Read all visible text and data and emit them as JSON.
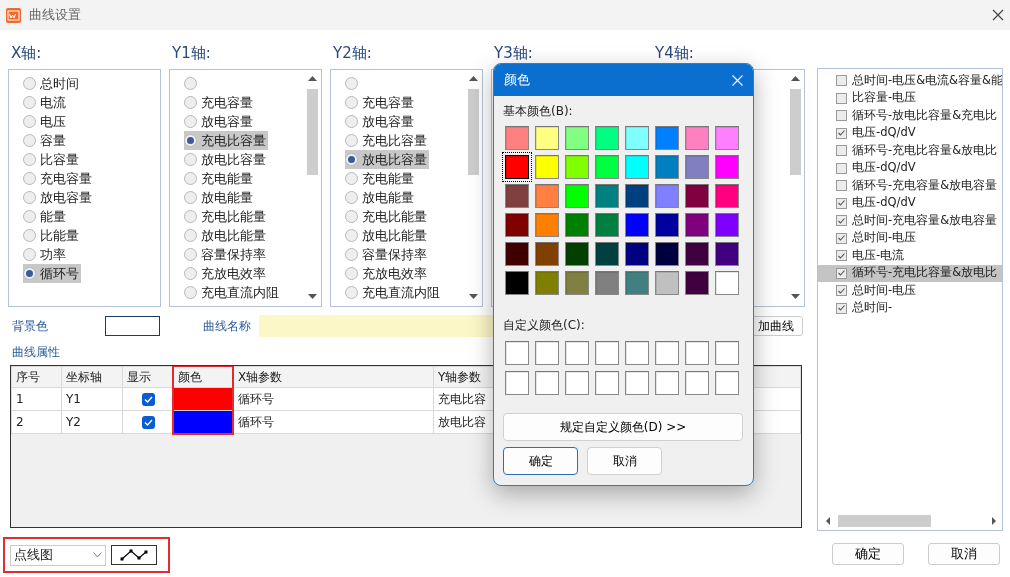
{
  "window": {
    "title": "曲线设置"
  },
  "axes": [
    {
      "label": "X轴:",
      "kind": "plain",
      "items": [
        {
          "label": "总时间",
          "selected": false
        },
        {
          "label": "电流",
          "selected": false
        },
        {
          "label": "电压",
          "selected": false
        },
        {
          "label": "容量",
          "selected": false
        },
        {
          "label": "比容量",
          "selected": false
        },
        {
          "label": "充电容量",
          "selected": false
        },
        {
          "label": "放电容量",
          "selected": false
        },
        {
          "label": "能量",
          "selected": false
        },
        {
          "label": "比能量",
          "selected": false
        },
        {
          "label": "功率",
          "selected": false
        },
        {
          "label": "循环号",
          "selected": true
        }
      ]
    },
    {
      "label": "Y1轴:",
      "kind": "scrolling",
      "items": [
        {
          "selected": false
        },
        {
          "label": "充电容量",
          "selected": false
        },
        {
          "label": "放电容量",
          "selected": false
        },
        {
          "label": "充电比容量",
          "selected": true
        },
        {
          "label": "放电比容量",
          "selected": false
        },
        {
          "label": "充电能量",
          "selected": false
        },
        {
          "label": "放电能量",
          "selected": false
        },
        {
          "label": "充电比能量",
          "selected": false
        },
        {
          "label": "放电比能量",
          "selected": false
        },
        {
          "label": "容量保持率",
          "selected": false
        },
        {
          "label": "充放电效率",
          "selected": false
        },
        {
          "label": "充电直流内阻",
          "selected": false
        }
      ]
    },
    {
      "label": "Y2轴:",
      "kind": "scrolling",
      "items": [
        {
          "selected": false
        },
        {
          "label": "充电容量",
          "selected": false
        },
        {
          "label": "放电容量",
          "selected": false
        },
        {
          "label": "充电比容量",
          "selected": false
        },
        {
          "label": "放电比容量",
          "selected": true
        },
        {
          "label": "充电能量",
          "selected": false
        },
        {
          "label": "放电能量",
          "selected": false
        },
        {
          "label": "充电比能量",
          "selected": false
        },
        {
          "label": "放电比能量",
          "selected": false
        },
        {
          "label": "容量保持率",
          "selected": false
        },
        {
          "label": "充放电效率",
          "selected": false
        },
        {
          "label": "充电直流内阻",
          "selected": false
        }
      ]
    },
    {
      "label": "Y3轴:",
      "kind": "plain"
    },
    {
      "label": "Y4轴:",
      "kind": "scrolling"
    }
  ],
  "background_color": {
    "label": "背景色"
  },
  "curve_name": {
    "label": "曲线名称"
  },
  "add_curve_button": "加曲线",
  "curve_properties": {
    "title": "曲线属性",
    "columns": [
      "序号",
      "坐标轴",
      "显示",
      "颜色",
      "X轴参数",
      "Y轴参数"
    ],
    "rows": [
      {
        "index": "1",
        "axis": "Y1",
        "shown": true,
        "color": "#ff0000",
        "x_param": "循环号",
        "y_param": "充电比容"
      },
      {
        "index": "2",
        "axis": "Y2",
        "shown": true,
        "color": "#0000ff",
        "x_param": "循环号",
        "y_param": "放电比容"
      }
    ]
  },
  "chart_type": {
    "value": "点线图"
  },
  "curve_list": [
    {
      "label": "总时间-电压&电流&容量&能",
      "checked": false,
      "selected": false
    },
    {
      "label": "比容量-电压",
      "checked": false,
      "selected": false
    },
    {
      "label": "循环号-放电比容量&充电比",
      "checked": false,
      "selected": false
    },
    {
      "label": "电压-dQ/dV",
      "checked": true,
      "selected": false
    },
    {
      "label": "循环号-充电比容量&放电比",
      "checked": false,
      "selected": false
    },
    {
      "label": "电压-dQ/dV",
      "checked": false,
      "selected": false
    },
    {
      "label": "循环号-充电容量&放电容量",
      "checked": false,
      "selected": false
    },
    {
      "label": "电压-dQ/dV",
      "checked": true,
      "selected": false
    },
    {
      "label": "总时间-充电容量&放电容量",
      "checked": true,
      "selected": false
    },
    {
      "label": "总时间-电压",
      "checked": true,
      "selected": false
    },
    {
      "label": "电压-电流",
      "checked": true,
      "selected": false
    },
    {
      "label": "循环号-充电比容量&放电比",
      "checked": true,
      "selected": true
    },
    {
      "label": "总时间-电压",
      "checked": true,
      "selected": false
    },
    {
      "label": "总时间-",
      "checked": true,
      "selected": false
    }
  ],
  "buttons": [
    "确定",
    "取消"
  ],
  "color_dialog": {
    "title": "颜色",
    "basic_label": "基本颜色(B):",
    "basic_colors": [
      {
        "color": "#ff8080",
        "selected": false
      },
      {
        "color": "#ffff80",
        "selected": false
      },
      {
        "color": "#80ff80",
        "selected": false
      },
      {
        "color": "#00ff80",
        "selected": false
      },
      {
        "color": "#80ffff",
        "selected": false
      },
      {
        "color": "#0080ff",
        "selected": false
      },
      {
        "color": "#ff80c0",
        "selected": false
      },
      {
        "color": "#ff80ff",
        "selected": false
      },
      {
        "color": "#ff0000",
        "selected": true
      },
      {
        "color": "#ffff00",
        "selected": false
      },
      {
        "color": "#80ff00",
        "selected": false
      },
      {
        "color": "#00ff40",
        "selected": false
      },
      {
        "color": "#00ffff",
        "selected": false
      },
      {
        "color": "#0080c0",
        "selected": false
      },
      {
        "color": "#8080c0",
        "selected": false
      },
      {
        "color": "#ff00ff",
        "selected": false
      },
      {
        "color": "#804040",
        "selected": false
      },
      {
        "color": "#ff8040",
        "selected": false
      },
      {
        "color": "#00ff00",
        "selected": false
      },
      {
        "color": "#008080",
        "selected": false
      },
      {
        "color": "#004080",
        "selected": false
      },
      {
        "color": "#8080ff",
        "selected": false
      },
      {
        "color": "#800040",
        "selected": false
      },
      {
        "color": "#ff0080",
        "selected": false
      },
      {
        "color": "#800000",
        "selected": false
      },
      {
        "color": "#ff8000",
        "selected": false
      },
      {
        "color": "#008000",
        "selected": false
      },
      {
        "color": "#008040",
        "selected": false
      },
      {
        "color": "#0000ff",
        "selected": false
      },
      {
        "color": "#0000a0",
        "selected": false
      },
      {
        "color": "#800080",
        "selected": false
      },
      {
        "color": "#8000ff",
        "selected": false
      },
      {
        "color": "#400000",
        "selected": false
      },
      {
        "color": "#804000",
        "selected": false
      },
      {
        "color": "#004000",
        "selected": false
      },
      {
        "color": "#004040",
        "selected": false
      },
      {
        "color": "#000080",
        "selected": false
      },
      {
        "color": "#000040",
        "selected": false
      },
      {
        "color": "#400040",
        "selected": false
      },
      {
        "color": "#400080",
        "selected": false
      },
      {
        "color": "#000000",
        "selected": false
      },
      {
        "color": "#808000",
        "selected": false
      },
      {
        "color": "#808040",
        "selected": false
      },
      {
        "color": "#808080",
        "selected": false
      },
      {
        "color": "#408080",
        "selected": false
      },
      {
        "color": "#c0c0c0",
        "selected": false
      },
      {
        "color": "#400040",
        "selected": false
      },
      {
        "color": "#ffffff",
        "selected": false
      }
    ],
    "custom_label": "自定义颜色(C):",
    "custom_colors": [
      {
        "kind": "empty"
      },
      {
        "kind": "empty"
      },
      {
        "kind": "empty"
      },
      {
        "kind": "empty"
      },
      {
        "kind": "empty"
      },
      {
        "kind": "empty"
      },
      {
        "kind": "empty"
      },
      {
        "kind": "empty"
      },
      {
        "kind": "empty"
      },
      {
        "kind": "empty"
      },
      {
        "kind": "empty"
      },
      {
        "kind": "empty"
      },
      {
        "kind": "empty"
      },
      {
        "kind": "empty"
      },
      {
        "kind": "empty"
      },
      {
        "kind": "empty"
      }
    ],
    "define_button": "规定自定义颜色(D) >>",
    "ok_button": "确定",
    "cancel_button": "取消"
  }
}
